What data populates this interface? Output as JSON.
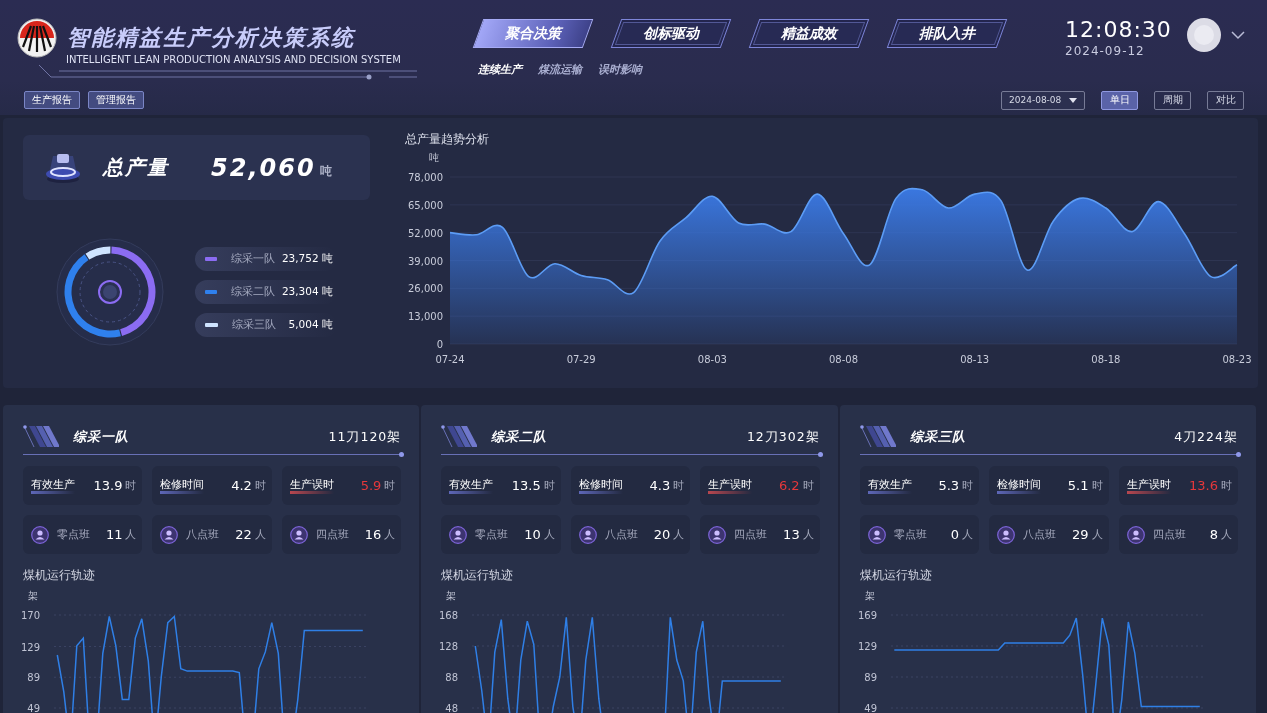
{
  "header": {
    "title": "智能精益生产分析决策系统",
    "subtitle": "INTELLIGENT LEAN PRODUCTION ANALYSIS AND DECISION SYSTEM",
    "nav_tabs": [
      {
        "label": "聚合决策",
        "selected": true
      },
      {
        "label": "创标驱动",
        "selected": false
      },
      {
        "label": "精益成效",
        "selected": false
      },
      {
        "label": "排队入井",
        "selected": false
      }
    ],
    "sub_tabs": [
      {
        "label": "连续生产",
        "selected": true
      },
      {
        "label": "煤流运输",
        "selected": false
      },
      {
        "label": "误时影响",
        "selected": false
      }
    ],
    "time": "12:08:30",
    "date": "2024-09-12"
  },
  "report_buttons": [
    "生产报告",
    "管理报告"
  ],
  "date_picker": {
    "value": "2024-08-08"
  },
  "period_buttons": [
    {
      "label": "单日",
      "selected": true
    },
    {
      "label": "周期",
      "selected": false
    },
    {
      "label": "对比",
      "selected": false
    }
  ],
  "total": {
    "label": "总产量",
    "value": "52,060",
    "unit": "吨",
    "teams": [
      {
        "name": "综采一队",
        "value": "23,752 吨",
        "color": "#8b6cf2"
      },
      {
        "name": "综采二队",
        "value": "23,304 吨",
        "color": "#2f80ed"
      },
      {
        "name": "综采三队",
        "value": "5,004 吨",
        "color": "#cfe4ff"
      }
    ],
    "chart_data": {
      "type": "donut",
      "values": [
        45.6,
        44.8,
        9.6
      ]
    }
  },
  "trend": {
    "chart_data": {
      "type": "area",
      "title": "总产量趋势分析",
      "ylabel": "吨",
      "categories": [
        "07-24",
        null,
        null,
        null,
        null,
        "07-29",
        null,
        null,
        null,
        null,
        "08-03",
        null,
        null,
        null,
        null,
        "08-08",
        null,
        null,
        null,
        null,
        "08-13",
        null,
        null,
        null,
        null,
        "08-18",
        null,
        null,
        null,
        null,
        "08-23"
      ],
      "grid": true,
      "yticks": [
        0,
        {
          "value": 13000,
          "label": "13,000"
        },
        {
          "value": 26000,
          "label": "26,000"
        },
        {
          "value": 39000,
          "label": "39,000"
        },
        {
          "value": 52000,
          "label": "52,000"
        },
        {
          "value": 65000,
          "label": "65,000"
        },
        {
          "value": 78000,
          "label": "78,000"
        }
      ],
      "ylim": [
        0,
        78000
      ],
      "series": [
        {
          "color": "#3b7be8",
          "values": [
            52000,
            51000,
            54500,
            31500,
            37500,
            32000,
            30000,
            24000,
            48000,
            59000,
            69000,
            56500,
            56000,
            52500,
            70000,
            51500,
            37000,
            68000,
            72000,
            63500,
            70000,
            67000,
            34500,
            57500,
            68000,
            63500,
            52500,
            66500,
            51500,
            31500,
            37000
          ]
        }
      ]
    }
  },
  "teams": [
    {
      "name": "综采一队",
      "spec": "11刀120架",
      "metrics": [
        {
          "label": "有效生产",
          "value": "13.9",
          "unit": "时",
          "alert": false
        },
        {
          "label": "检修时间",
          "value": "4.2",
          "unit": "时",
          "alert": false
        },
        {
          "label": "生产误时",
          "value": "5.9",
          "unit": "时",
          "alert": true
        }
      ],
      "shifts": [
        {
          "label": "零点班",
          "count": "11",
          "unit": "人"
        },
        {
          "label": "八点班",
          "count": "22",
          "unit": "人"
        },
        {
          "label": "四点班",
          "count": "16",
          "unit": "人"
        }
      ],
      "chart_data": {
        "type": "line",
        "title": "煤机运行轨迹",
        "ylabel": "架",
        "grid": true,
        "yticks": [
          170,
          129,
          89,
          49
        ],
        "ylim": [
          49,
          170
        ],
        "categories": [
          null,
          null,
          null,
          null,
          null,
          null,
          null,
          null,
          null,
          null,
          null,
          null,
          null,
          null,
          null,
          null,
          null,
          null,
          null,
          null,
          null,
          null,
          null,
          null,
          null,
          null,
          null,
          null,
          null,
          null,
          null,
          null,
          null,
          null,
          null,
          null,
          null,
          null,
          null,
          null,
          null,
          null,
          null,
          null,
          null,
          null,
          null,
          null
        ],
        "series": [
          {
            "color": "#2f7fe6",
            "values": [
              118,
              70,
              null,
              130,
              140,
              null,
              null,
              120,
              168,
              130,
              60,
              60,
              140,
              165,
              110,
              null,
              90,
              160,
              168,
              100,
              97,
              97,
              97,
              97,
              97,
              97,
              97,
              97,
              95,
              null,
              null,
              100,
              122,
              160,
              120,
              null,
              null,
              60,
              150,
              150,
              150,
              150,
              150,
              150,
              150,
              150,
              150,
              150
            ]
          }
        ]
      }
    },
    {
      "name": "综采二队",
      "spec": "12刀302架",
      "metrics": [
        {
          "label": "有效生产",
          "value": "13.5",
          "unit": "时",
          "alert": false
        },
        {
          "label": "检修时间",
          "value": "4.3",
          "unit": "时",
          "alert": false
        },
        {
          "label": "生产误时",
          "value": "6.2",
          "unit": "时",
          "alert": true
        }
      ],
      "shifts": [
        {
          "label": "零点班",
          "count": "10",
          "unit": "人"
        },
        {
          "label": "八点班",
          "count": "20",
          "unit": "人"
        },
        {
          "label": "四点班",
          "count": "13",
          "unit": "人"
        }
      ],
      "chart_data": {
        "type": "line",
        "title": "煤机运行轨迹",
        "ylabel": "架",
        "grid": true,
        "yticks": [
          168,
          128,
          88,
          48
        ],
        "ylim": [
          48,
          168
        ],
        "categories": [
          null,
          null,
          null,
          null,
          null,
          null,
          null,
          null,
          null,
          null,
          null,
          null,
          null,
          null,
          null,
          null,
          null,
          null,
          null,
          null,
          null,
          null,
          null,
          null,
          null,
          null,
          null,
          null,
          null,
          null,
          null,
          null,
          null,
          null,
          null,
          null,
          null,
          null,
          null,
          null,
          null,
          null,
          null,
          null,
          null,
          null,
          null,
          null
        ],
        "series": [
          {
            "color": "#2f7fe6",
            "values": [
              128,
              70,
              null,
              120,
              162,
              60,
              null,
              110,
              160,
              130,
              null,
              null,
              50,
              88,
              165,
              50,
              null,
              110,
              165,
              60,
              null,
              null,
              null,
              null,
              null,
              null,
              null,
              null,
              null,
              null,
              165,
              110,
              83,
              null,
              120,
              160,
              60,
              null,
              83,
              83,
              83,
              83,
              83,
              83,
              83,
              83,
              83,
              83
            ]
          }
        ]
      }
    },
    {
      "name": "综采三队",
      "spec": "4刀224架",
      "metrics": [
        {
          "label": "有效生产",
          "value": "5.3",
          "unit": "时",
          "alert": false
        },
        {
          "label": "检修时间",
          "value": "5.1",
          "unit": "时",
          "alert": false
        },
        {
          "label": "生产误时",
          "value": "13.6",
          "unit": "时",
          "alert": true
        }
      ],
      "shifts": [
        {
          "label": "零点班",
          "count": "0",
          "unit": "人"
        },
        {
          "label": "八点班",
          "count": "29",
          "unit": "人"
        },
        {
          "label": "四点班",
          "count": "8",
          "unit": "人"
        }
      ],
      "chart_data": {
        "type": "line",
        "title": "煤机运行轨迹",
        "ylabel": "架",
        "grid": true,
        "yticks": [
          169,
          129,
          89,
          49
        ],
        "ylim": [
          49,
          169
        ],
        "categories": [
          null,
          null,
          null,
          null,
          null,
          null,
          null,
          null,
          null,
          null,
          null,
          null,
          null,
          null,
          null,
          null,
          null,
          null,
          null,
          null,
          null,
          null,
          null,
          null,
          null,
          null,
          null,
          null,
          null,
          null,
          null,
          null,
          null,
          null,
          null,
          null,
          null,
          null,
          null,
          null,
          null,
          null,
          null,
          null,
          null,
          null,
          null,
          null
        ],
        "series": [
          {
            "color": "#2f7fe6",
            "values": [
              124,
              124,
              124,
              124,
              124,
              124,
              124,
              124,
              124,
              124,
              124,
              124,
              124,
              124,
              124,
              124,
              124,
              133,
              133,
              133,
              133,
              133,
              133,
              133,
              133,
              133,
              133,
              143,
              165,
              90,
              null,
              80,
              165,
              130,
              null,
              60,
              160,
              120,
              51,
              51,
              51,
              51,
              51,
              51,
              51,
              51,
              51,
              51
            ]
          }
        ]
      }
    }
  ]
}
